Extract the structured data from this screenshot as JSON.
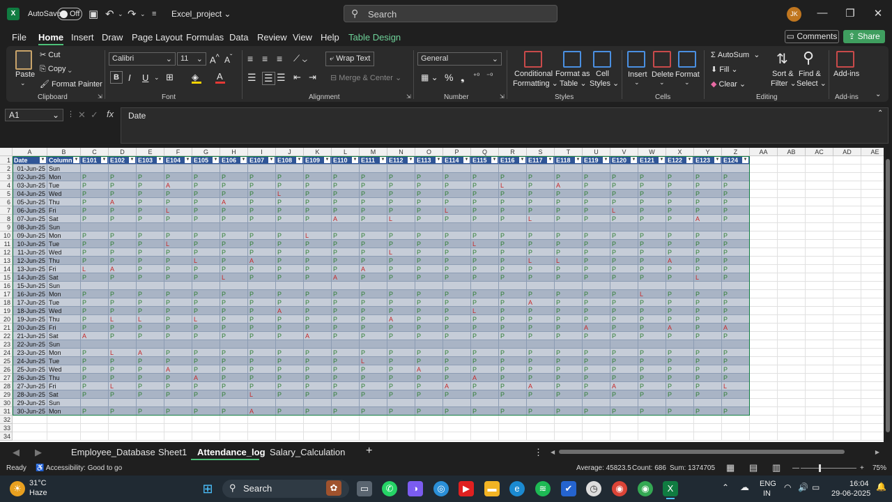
{
  "titlebar": {
    "autosave_label": "AutoSave",
    "toggle_state": "Off",
    "filename": "Excel_project",
    "search_placeholder": "Search",
    "user_initials": "JK"
  },
  "menu": [
    "File",
    "Home",
    "Insert",
    "Draw",
    "Page Layout",
    "Formulas",
    "Data",
    "Review",
    "View",
    "Help",
    "Table Design"
  ],
  "menu_active": "Home",
  "buttons": {
    "comments": "Comments",
    "share": "Share"
  },
  "ribbon": {
    "clipboard": {
      "paste": "Paste",
      "cut": "Cut",
      "copy": "Copy",
      "format_painter": "Format Painter",
      "group": "Clipboard"
    },
    "font": {
      "name": "Calibri",
      "size": "11",
      "group": "Font"
    },
    "alignment": {
      "wrap": "Wrap Text",
      "merge": "Merge & Center",
      "group": "Alignment"
    },
    "number": {
      "format": "General",
      "group": "Number"
    },
    "styles": {
      "conditional1": "Conditional",
      "conditional2": "Formatting",
      "format_table1": "Format as",
      "format_table2": "Table",
      "cell_styles1": "Cell",
      "cell_styles2": "Styles",
      "group": "Styles"
    },
    "cells": {
      "insert": "Insert",
      "delete": "Delete",
      "format": "Format",
      "group": "Cells"
    },
    "editing": {
      "autosum": "AutoSum",
      "fill": "Fill",
      "clear": "Clear",
      "sort1": "Sort &",
      "sort2": "Filter",
      "find1": "Find &",
      "find2": "Select",
      "group": "Editing"
    },
    "addins": {
      "label": "Add-ins",
      "group": "Add-ins"
    }
  },
  "formula_bar": {
    "name_box": "A1",
    "fx": "fx",
    "content": "Date"
  },
  "grid": {
    "columns": [
      "A",
      "B",
      "C",
      "D",
      "E",
      "F",
      "G",
      "H",
      "I",
      "J",
      "K",
      "L",
      "M",
      "N",
      "O",
      "P",
      "Q",
      "R",
      "S",
      "T",
      "U",
      "V",
      "W",
      "X",
      "Y",
      "Z",
      "AA",
      "AB",
      "AC",
      "AD",
      "AE"
    ],
    "headers": [
      "Date",
      "Column",
      "E101",
      "E102",
      "E103",
      "E104",
      "E105",
      "E106",
      "E107",
      "E108",
      "E109",
      "E110",
      "E111",
      "E112",
      "E113",
      "E114",
      "E115",
      "E116",
      "E117",
      "E118",
      "E119",
      "E120",
      "E121",
      "E122",
      "E123",
      "E124"
    ],
    "rows": [
      {
        "date": "01-Jun-25",
        "day": "Sun",
        "v": ""
      },
      {
        "date": "02-Jun-25",
        "day": "Mon",
        "v": "PPPPPPPPPPPPPPPPPPPPPPPP"
      },
      {
        "date": "03-Jun-25",
        "day": "Tue",
        "v": "PPPAPPPPPPPPPPPLPAPPPPPP"
      },
      {
        "date": "04-Jun-25",
        "day": "Wed",
        "v": "PPPPPPPLPPPPPPPPPPPPPPPP"
      },
      {
        "date": "05-Jun-25",
        "day": "Thu",
        "v": "PAPPPAPPPPPPPPPPPPPPPPPP"
      },
      {
        "date": "06-Jun-25",
        "day": "Fri",
        "v": "PPPLPPPPPPPPPLPPPPPLPPPP"
      },
      {
        "date": "07-Jun-25",
        "day": "Sat",
        "v": "PPPPPPPPPAPLPPPPLPPPPPAP"
      },
      {
        "date": "08-Jun-25",
        "day": "Sun",
        "v": ""
      },
      {
        "date": "09-Jun-25",
        "day": "Mon",
        "v": "PPPPPPPPLPPPPPPPPPPPPPPP"
      },
      {
        "date": "10-Jun-25",
        "day": "Tue",
        "v": "PPPLPPPPPPPPPPLPPPPPPPPP"
      },
      {
        "date": "11-Jun-25",
        "day": "Wed",
        "v": "PPPPPPPPPPPLPPPPPPPPPPPP"
      },
      {
        "date": "12-Jun-25",
        "day": "Thu",
        "v": "PPPPLPAPPPPPPPPPLLPPPAPP"
      },
      {
        "date": "13-Jun-25",
        "day": "Fri",
        "v": "LAPPPPPPPPAPPPPPPPPPPPPP"
      },
      {
        "date": "14-Jun-25",
        "day": "Sat",
        "v": "PPPPPLPPPAPPPPPPPPPPPPLP"
      },
      {
        "date": "15-Jun-25",
        "day": "Sun",
        "v": ""
      },
      {
        "date": "16-Jun-25",
        "day": "Mon",
        "v": "PPPPPPPPPPPPPPPPPPPPLPPP"
      },
      {
        "date": "17-Jun-25",
        "day": "Tue",
        "v": "PPPPPPPPPPPPPPPPAPPPPPPP"
      },
      {
        "date": "18-Jun-25",
        "day": "Wed",
        "v": "PPPPPPPAPPPPPPLPPPPPPPPP"
      },
      {
        "date": "19-Jun-25",
        "day": "Thu",
        "v": "PLLPLPPPPPPAPPPPPPPPPPPP"
      },
      {
        "date": "20-Jun-25",
        "day": "Fri",
        "v": "PPPPPPPPPPPPPPPPPPAPPAPA"
      },
      {
        "date": "21-Jun-25",
        "day": "Sat",
        "v": "APPPPPPPAPPPPPPPPPPPPPPP"
      },
      {
        "date": "22-Jun-25",
        "day": "Sun",
        "v": ""
      },
      {
        "date": "23-Jun-25",
        "day": "Mon",
        "v": "PLAPPPPPPPPPPPPPPPPPPPPP"
      },
      {
        "date": "24-Jun-25",
        "day": "Tue",
        "v": "PPPPPPPPPPLPPPPPPPPPPPPP"
      },
      {
        "date": "25-Jun-25",
        "day": "Wed",
        "v": "PPPAPPPPPPPPAPPPPPPPPPPP"
      },
      {
        "date": "26-Jun-25",
        "day": "Thu",
        "v": "PPPPAPPPPPPPPPAPPPPPPPPP"
      },
      {
        "date": "27-Jun-25",
        "day": "Fri",
        "v": "PLPPPPPPPPPPPAPPAPPAPPPL"
      },
      {
        "date": "28-Jun-25",
        "day": "Sat",
        "v": "PPPPPPLPPPPPPPPPPPPPPPPP"
      },
      {
        "date": "29-Jun-25",
        "day": "Sun",
        "v": ""
      },
      {
        "date": "30-Jun-25",
        "day": "Mon",
        "v": "PPPPPPAPPPPPPPPPPPPPPPPP"
      }
    ],
    "extra_row_numbers": [
      "32",
      "33",
      "34"
    ]
  },
  "sheets": [
    "Employee_Database",
    "Sheet1",
    "Attendance_log",
    "Salary_Calculation"
  ],
  "active_sheet": "Attendance_log",
  "status": {
    "ready": "Ready",
    "accessibility": "Accessibility: Good to go",
    "average": "Average: 45823.5",
    "count": "Count: 686",
    "sum": "Sum: 1374705",
    "zoom": "75%"
  },
  "taskbar": {
    "weather_temp": "31°C",
    "weather_desc": "Haze",
    "search": "Search",
    "lang1": "ENG",
    "lang2": "IN",
    "time": "16:04",
    "date": "29-06-2025"
  }
}
